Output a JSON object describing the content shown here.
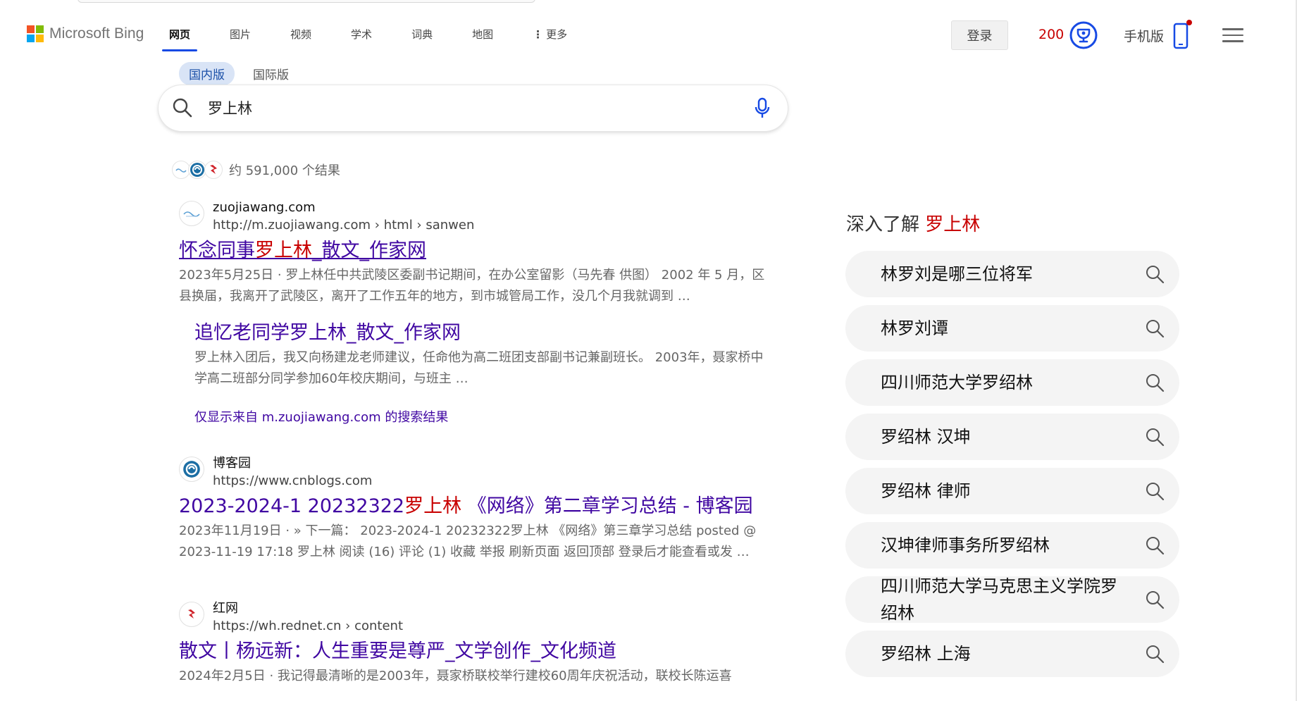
{
  "header": {
    "brand": "Microsoft Bing",
    "nav": [
      {
        "label": "网页",
        "active": true
      },
      {
        "label": "图片",
        "active": false
      },
      {
        "label": "视频",
        "active": false
      },
      {
        "label": "学术",
        "active": false
      },
      {
        "label": "词典",
        "active": false
      },
      {
        "label": "地图",
        "active": false
      }
    ],
    "more_label": "更多",
    "login_label": "登录",
    "points": "200",
    "mobile_label": "手机版"
  },
  "region": {
    "domestic": "国内版",
    "international": "国际版",
    "active": "国内版"
  },
  "search": {
    "query": "罗上林"
  },
  "results_count": "约 591,000 个结果",
  "results": [
    {
      "site_name": "zuojiawang.com",
      "url": "http://m.zuojiawang.com › html › sanwen",
      "title_pre": "怀念同事",
      "title_hl": "罗上林",
      "title_post": "_散文_作家网",
      "date": "2023年5月25日",
      "snippet": "罗上林任中共武陵区委副书记期间，在办公室留影（马先春 供图） 2002 年 5 月，区县换届，我离开了武陵区，离开了工作五年的地方，到市城管局工作，没几个月我就调到 …",
      "sub": {
        "title": "追忆老同学罗上林_散文_作家网",
        "snippet": "罗上林入团后，我又向杨建龙老师建议，任命他为高二班团支部副书记兼副班长。 2003年，聂家桥中学高二班部分同学参加60年校庆期间，与班主 …"
      },
      "only_from": "仅显示来自 m.zuojiawang.com 的搜索结果"
    },
    {
      "site_name": "博客园",
      "url": "https://www.cnblogs.com",
      "title_pre": "2023-2024-1 20232322",
      "title_hl": "罗上林",
      "title_post": " 《网络》第二章学习总结 - 博客园",
      "date": "2023年11月19日",
      "snippet": "» 下一篇： 2023-2024-1 20232322罗上林 《网络》第三章学习总结 posted @ 2023-11-19 17:18 罗上林 阅读 (16) 评论 (1) 收藏 举报 刷新页面 返回顶部 登录后才能查看或发 …"
    },
    {
      "site_name": "红网",
      "url": "https://wh.rednet.cn › content",
      "title_pre": "散文丨杨远新：人生重要是尊严_文学创作_文化频道",
      "title_hl": "",
      "title_post": "",
      "date": "2024年2月5日",
      "snippet": "我记得最清晰的是2003年，聂家桥联校举行建校60周年庆祝活动，联校长陈运喜"
    }
  ],
  "right_panel": {
    "title_prefix": "深入了解",
    "title_query": "罗上林",
    "related": [
      "林罗刘是哪三位将军",
      "林罗刘谭",
      "四川师范大学罗绍林",
      "罗绍林 汉坤",
      "罗绍林 律师",
      "汉坤律师事务所罗绍林",
      "四川师范大学马克思主义学院罗绍林",
      "罗绍林 上海"
    ]
  },
  "colors": {
    "link": "#4007a2",
    "highlight": "#c80000",
    "accent": "#174ae4",
    "points": "#c80000"
  },
  "icons": [
    "microsoft-logo-icon",
    "more-dots-icon",
    "trophy-icon",
    "phone-icon",
    "hamburger-menu-icon",
    "search-icon",
    "microphone-icon",
    "site-favicon-icon"
  ]
}
